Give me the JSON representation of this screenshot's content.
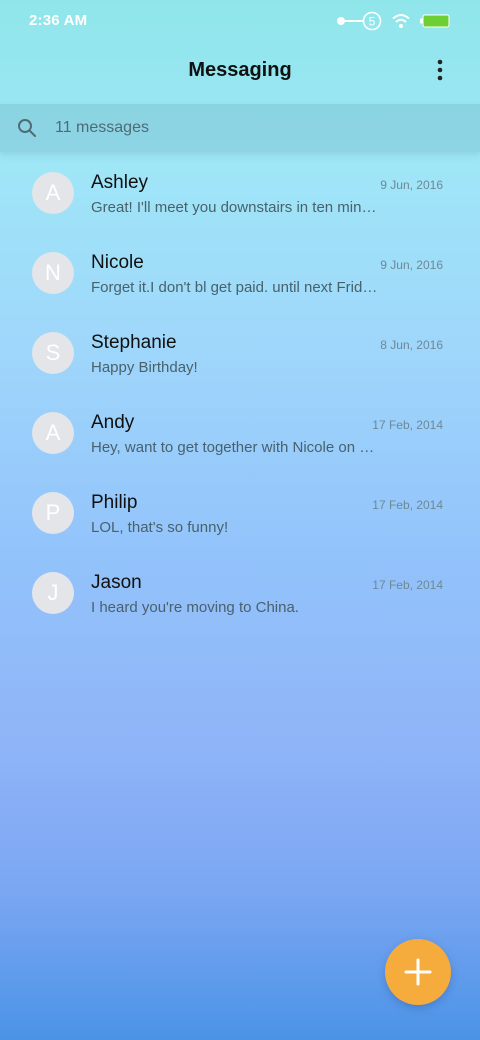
{
  "status_bar": {
    "time": "2:36 AM",
    "key_badge": "5",
    "icons": [
      "key-icon",
      "wifi-icon",
      "battery-icon"
    ],
    "battery_color": "#6ecf33"
  },
  "header": {
    "title": "Messaging",
    "overflow_icon": "more-vert-icon"
  },
  "search": {
    "icon": "search-icon",
    "placeholder": "11 messages"
  },
  "threads": [
    {
      "initial": "A",
      "name": "Ashley",
      "date": "9 Jun, 2016",
      "snippet": "Great! I'll meet you downstairs in ten min…"
    },
    {
      "initial": "N",
      "name": "Nicole",
      "date": "9 Jun, 2016",
      "snippet": "Forget it.I don't bl get paid. until next Frid…"
    },
    {
      "initial": "S",
      "name": "Stephanie",
      "date": "8 Jun, 2016",
      "snippet": "Happy Birthday!"
    },
    {
      "initial": "A",
      "name": "Andy",
      "date": "17 Feb, 2014",
      "snippet": "Hey, want to get together with Nicole on …"
    },
    {
      "initial": "P",
      "name": "Philip",
      "date": "17 Feb, 2014",
      "snippet": "LOL, that's so funny!"
    },
    {
      "initial": "J",
      "name": "Jason",
      "date": "17 Feb, 2014",
      "snippet": "I heard you're moving to China."
    }
  ],
  "fab": {
    "icon": "plus-icon",
    "color": "#f5ac3c"
  }
}
